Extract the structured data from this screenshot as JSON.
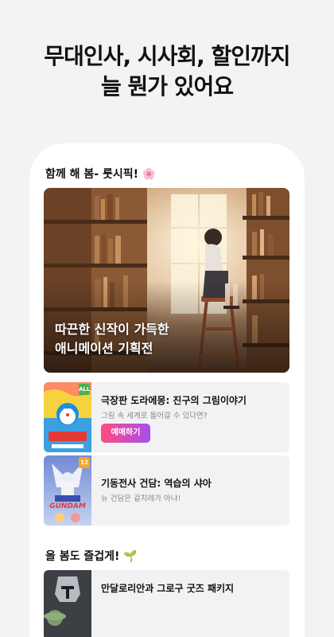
{
  "headline": {
    "line1": "무대인사, 시사회, 할인까지",
    "line2": "늘 뭔가 있어요"
  },
  "section1": {
    "title": "함께 해 봄- 룻시픽! 🌸",
    "hero": {
      "line1": "따끈한 신작이 가득한",
      "line2": "애니메이션 기획전"
    },
    "movies": [
      {
        "title": "극장판 도라에몽: 진구의 그림이야기",
        "subtitle": "그림 속 세계로 들어갈 수 있다면?",
        "button": "예매하기",
        "rating": "ALL",
        "rating_color": "#4caf50"
      },
      {
        "title": "기동전사 건담: 역습의 샤아",
        "subtitle": "뉴 건담은 겉치레가 아냐!",
        "rating": "12",
        "rating_color": "#f5a623"
      }
    ]
  },
  "section2": {
    "title": "올 봄도 즐겁게! 🌱",
    "items": [
      {
        "title": "만달로리안과 그로구 굿즈 패키지"
      }
    ]
  },
  "colors": {
    "background": "#f3f3f5",
    "button_gradient_start": "#ff4c7c",
    "button_gradient_end": "#a64df0"
  }
}
